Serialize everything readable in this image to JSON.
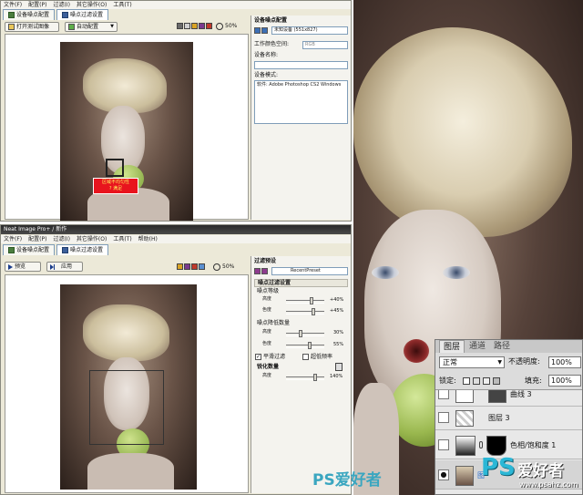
{
  "top_window": {
    "menu": [
      "文件(F)",
      "配置(P)",
      "过滤(I)",
      "其它操作(O)",
      "工具(T)"
    ],
    "tabs": [
      {
        "label": "设备噪点配置"
      },
      {
        "label": "噪点过滤设置"
      }
    ],
    "toolbar": {
      "open_label": "打开测试图像",
      "auto_label": "自动配置",
      "zoom": "50%"
    },
    "panel": {
      "title": "设备噪点配置",
      "preset_value": "未知设备 (551x827)",
      "color_space_label": "工作颜色空间:",
      "color_space_value": "RGB",
      "device_name_label": "设备名称:",
      "device_mode_label": "设备模式:",
      "device_mode_text": "软件: Adobe Photoshop CS2 Windows"
    },
    "overlay_text": [
      "区域不均匀性",
      "? 满足"
    ]
  },
  "bottom_window": {
    "title": "Neat Image Pro+ / 新作",
    "menu": [
      "文件(F)",
      "配置(P)",
      "过滤(I)",
      "其它操作(O)",
      "工具(T)",
      "帮助(H)"
    ],
    "tabs": [
      {
        "label": "设备噪点配置"
      },
      {
        "label": "噪点过滤设置"
      }
    ],
    "toolbar": {
      "preview_label": "预览",
      "apply_label": "应用",
      "zoom": "50%"
    },
    "panel": {
      "filter_preset_label": "过滤预设",
      "filter_preset_value": "RecentPreset",
      "noise_filter_section": "噪点过滤设置",
      "noise_level_label": "噪点等级",
      "noise_reduction_label": "噪点降低数量",
      "sharpen_label": "锐化数量",
      "mini_label_1": "高度",
      "mini_label_2": "色度",
      "slider_values": [
        "+40%",
        "+45%",
        "30%",
        "55%",
        "140%"
      ],
      "smooth_edges_label": "平滑过滤",
      "ultra_high_label": "超低频率"
    }
  },
  "layers_panel": {
    "tabs": [
      "图层",
      "通道",
      "路径"
    ],
    "blend_mode": "正常",
    "opacity_label": "不透明度:",
    "opacity_value": "100%",
    "lock_label": "锁定:",
    "fill_label": "填充:",
    "fill_value": "100%",
    "layers": [
      {
        "name": "曲线 3"
      },
      {
        "name": "图层 3"
      },
      {
        "name": "色相/饱和度 1"
      },
      {
        "name": "图"
      }
    ]
  },
  "watermarks": {
    "ps_center": "PS爱好者",
    "ps_logo": "PS",
    "ps_logo_text": "爱好者",
    "site": "www.psahz.com"
  },
  "colors": {
    "window_bg": "#ece9d8",
    "panel_bg": "#f4f3ee",
    "red_overlay": "#e8141e",
    "accent_blue": "#1a3c8c"
  }
}
